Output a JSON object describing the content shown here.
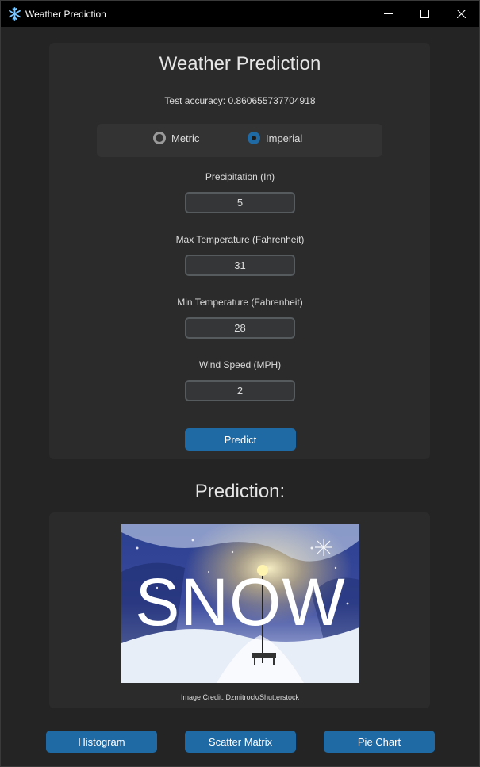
{
  "window": {
    "title": "Weather Prediction",
    "app_icon": "snowflake-icon",
    "controls": [
      "minimize-icon",
      "maximize-icon",
      "close-icon"
    ]
  },
  "form": {
    "heading": "Weather Prediction",
    "accuracy_text": "Test accuracy: 0.860655737704918",
    "units": {
      "options": [
        "Metric",
        "Imperial"
      ],
      "selected": "Imperial"
    },
    "fields": [
      {
        "label": "Precipitation (In)",
        "value": "5"
      },
      {
        "label": "Max Temperature (Fahrenheit)",
        "value": "31"
      },
      {
        "label": "Min Temperature (Fahrenheit)",
        "value": "28"
      },
      {
        "label": "Wind Speed (MPH)",
        "value": "2"
      }
    ],
    "predict_label": "Predict"
  },
  "prediction": {
    "heading": "Prediction:",
    "result_text": "SNOW",
    "image_credit": "Image Credit: Dzmitrock/Shutterstock"
  },
  "bottom_buttons": {
    "histogram": "Histogram",
    "scatter_matrix": "Scatter Matrix",
    "pie_chart": "Pie Chart"
  },
  "colors": {
    "accent": "#1f6aa5",
    "background": "#242424",
    "panel": "#2b2b2b",
    "entry_bg": "#343638",
    "entry_border": "#565b5e"
  }
}
